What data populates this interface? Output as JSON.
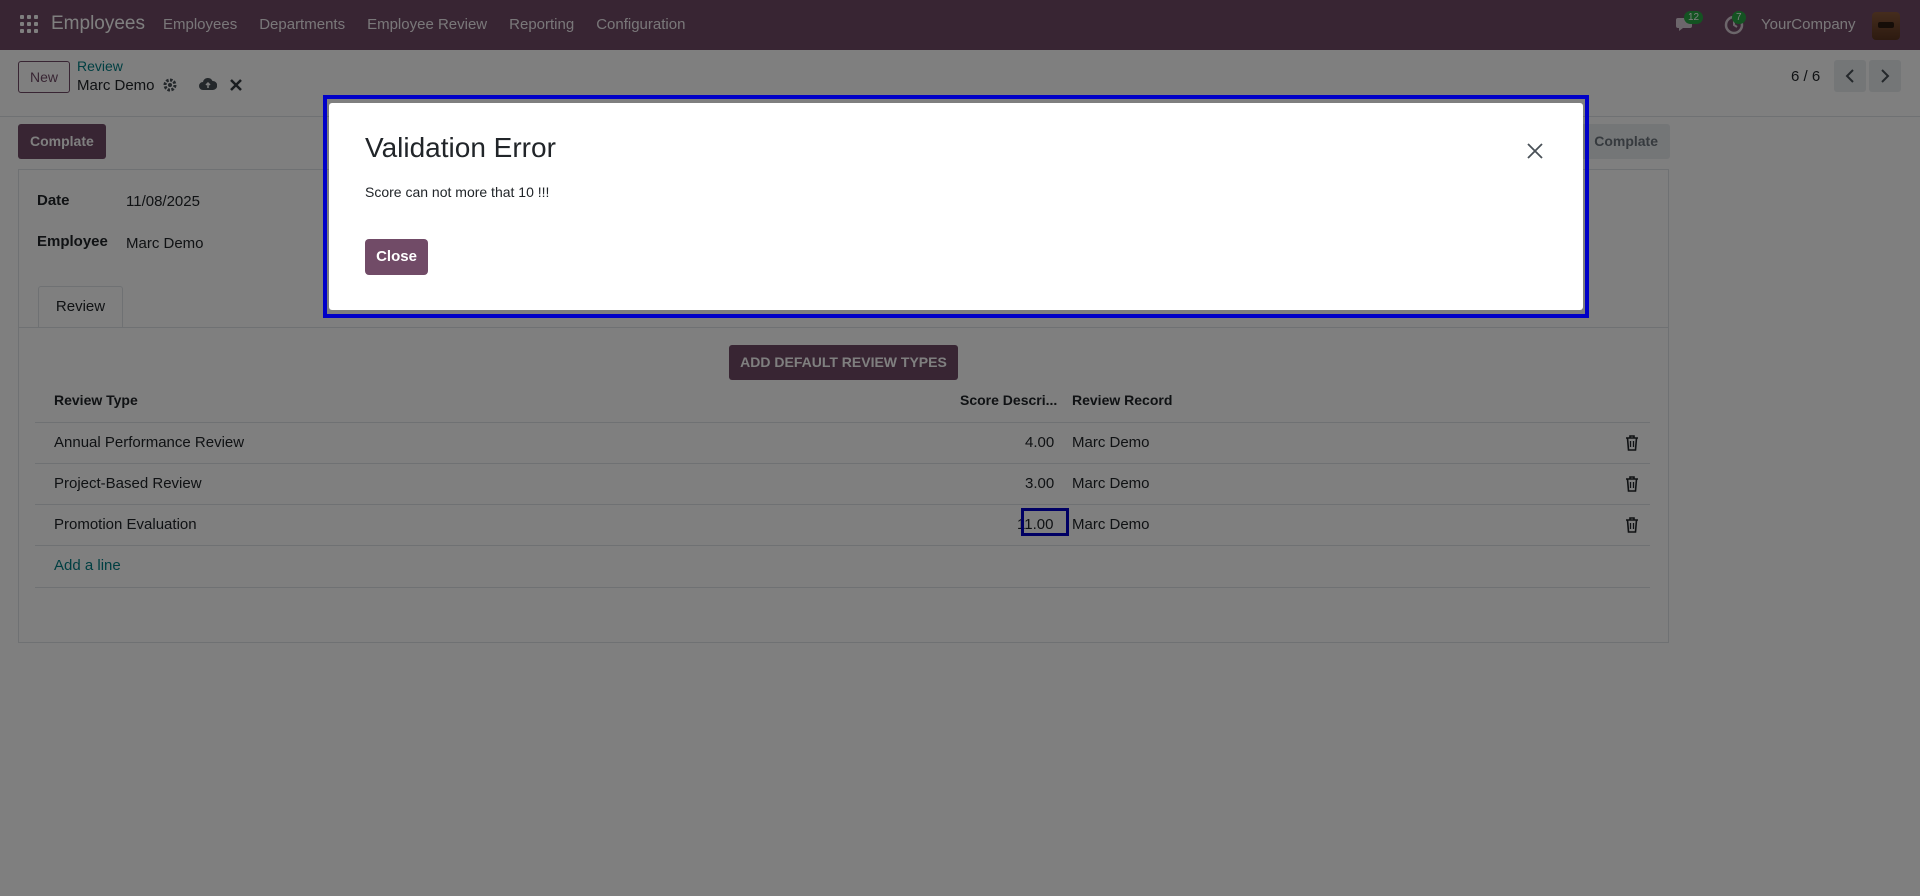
{
  "navbar": {
    "app_name": "Employees",
    "menu": [
      "Employees",
      "Departments",
      "Employee Review",
      "Reporting",
      "Configuration"
    ],
    "messages_count": "12",
    "activities_count": "7",
    "company": "YourCompany"
  },
  "control_panel": {
    "new_label": "New",
    "breadcrumb_parent": "Review",
    "breadcrumb_current": "Marc Demo",
    "pager": "6 / 6"
  },
  "status_bar": {
    "action_label": "Complate",
    "state_label": "Complate"
  },
  "form": {
    "date_label": "Date",
    "date_value": "11/08/2025",
    "employee_label": "Employee",
    "employee_value": "Marc Demo",
    "tab_label": "Review",
    "add_default_label": "ADD DEFAULT REVIEW TYPES",
    "columns": [
      "Review Type",
      "Score Descri...",
      "Review Record"
    ],
    "rows": [
      {
        "type": "Annual Performance Review",
        "score": "4.00",
        "record": "Marc Demo"
      },
      {
        "type": "Project-Based Review",
        "score": "3.00",
        "record": "Marc Demo"
      },
      {
        "type": "Promotion Evaluation",
        "score": "11.00",
        "record": "Marc Demo"
      }
    ],
    "add_line": "Add a line"
  },
  "dialog": {
    "title": "Validation Error",
    "message": "Score can not more that 10 !!!",
    "close_label": "Close"
  },
  "colors": {
    "brand": "#714b67",
    "highlight": "#0000c8",
    "badge": "#28a745"
  }
}
